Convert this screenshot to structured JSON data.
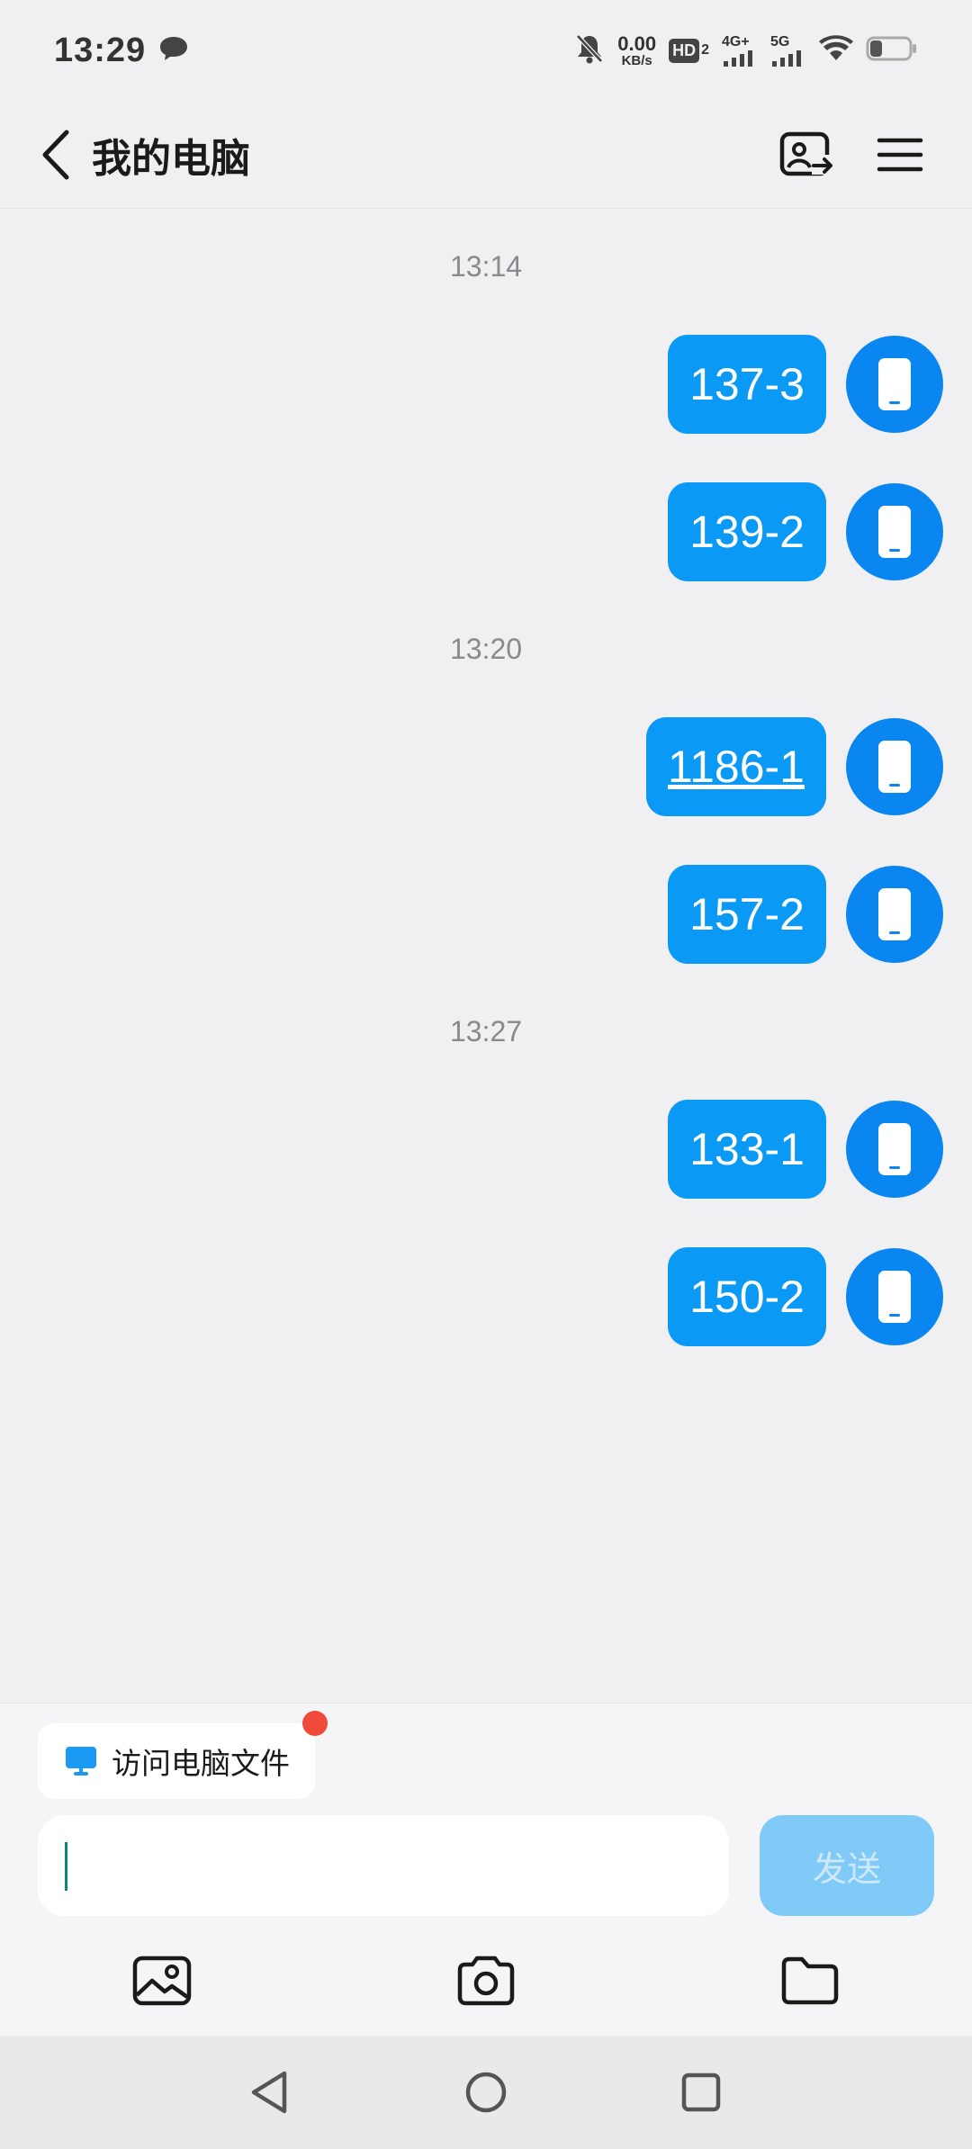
{
  "status_bar": {
    "time": "13:29",
    "net_speed_value": "0.00",
    "net_speed_unit": "KB/s",
    "hd_label": "HD",
    "hd_sub": "2",
    "net1_label": "4G+",
    "net2_label": "5G"
  },
  "header": {
    "title": "我的电脑"
  },
  "chat": {
    "groups": [
      {
        "time": "13:14",
        "messages": [
          {
            "text": "137-3",
            "link": false
          },
          {
            "text": "139-2",
            "link": false
          }
        ]
      },
      {
        "time": "13:20",
        "messages": [
          {
            "text": "1186-1",
            "link": true
          },
          {
            "text": "157-2",
            "link": false
          }
        ]
      },
      {
        "time": "13:27",
        "messages": [
          {
            "text": "133-1",
            "link": false
          },
          {
            "text": "150-2",
            "link": false
          }
        ]
      }
    ]
  },
  "bottom": {
    "pc_files_label": "访问电脑文件",
    "input_value": "",
    "send_label": "发送"
  },
  "colors": {
    "bubble": "#0a99f5",
    "avatar": "#0a86f0",
    "send_disabled": "#80caf8",
    "badge": "#f04a3a"
  },
  "icons": {
    "status": [
      "chat-bubble-icon",
      "mute-bell-icon",
      "signal-icon",
      "wifi-icon",
      "battery-icon"
    ],
    "header": [
      "back-arrow-icon",
      "screen-transfer-icon",
      "menu-icon"
    ],
    "tools": [
      "image-icon",
      "camera-icon",
      "folder-icon"
    ],
    "nav": [
      "nav-back-icon",
      "nav-home-icon",
      "nav-recents-icon"
    ]
  }
}
